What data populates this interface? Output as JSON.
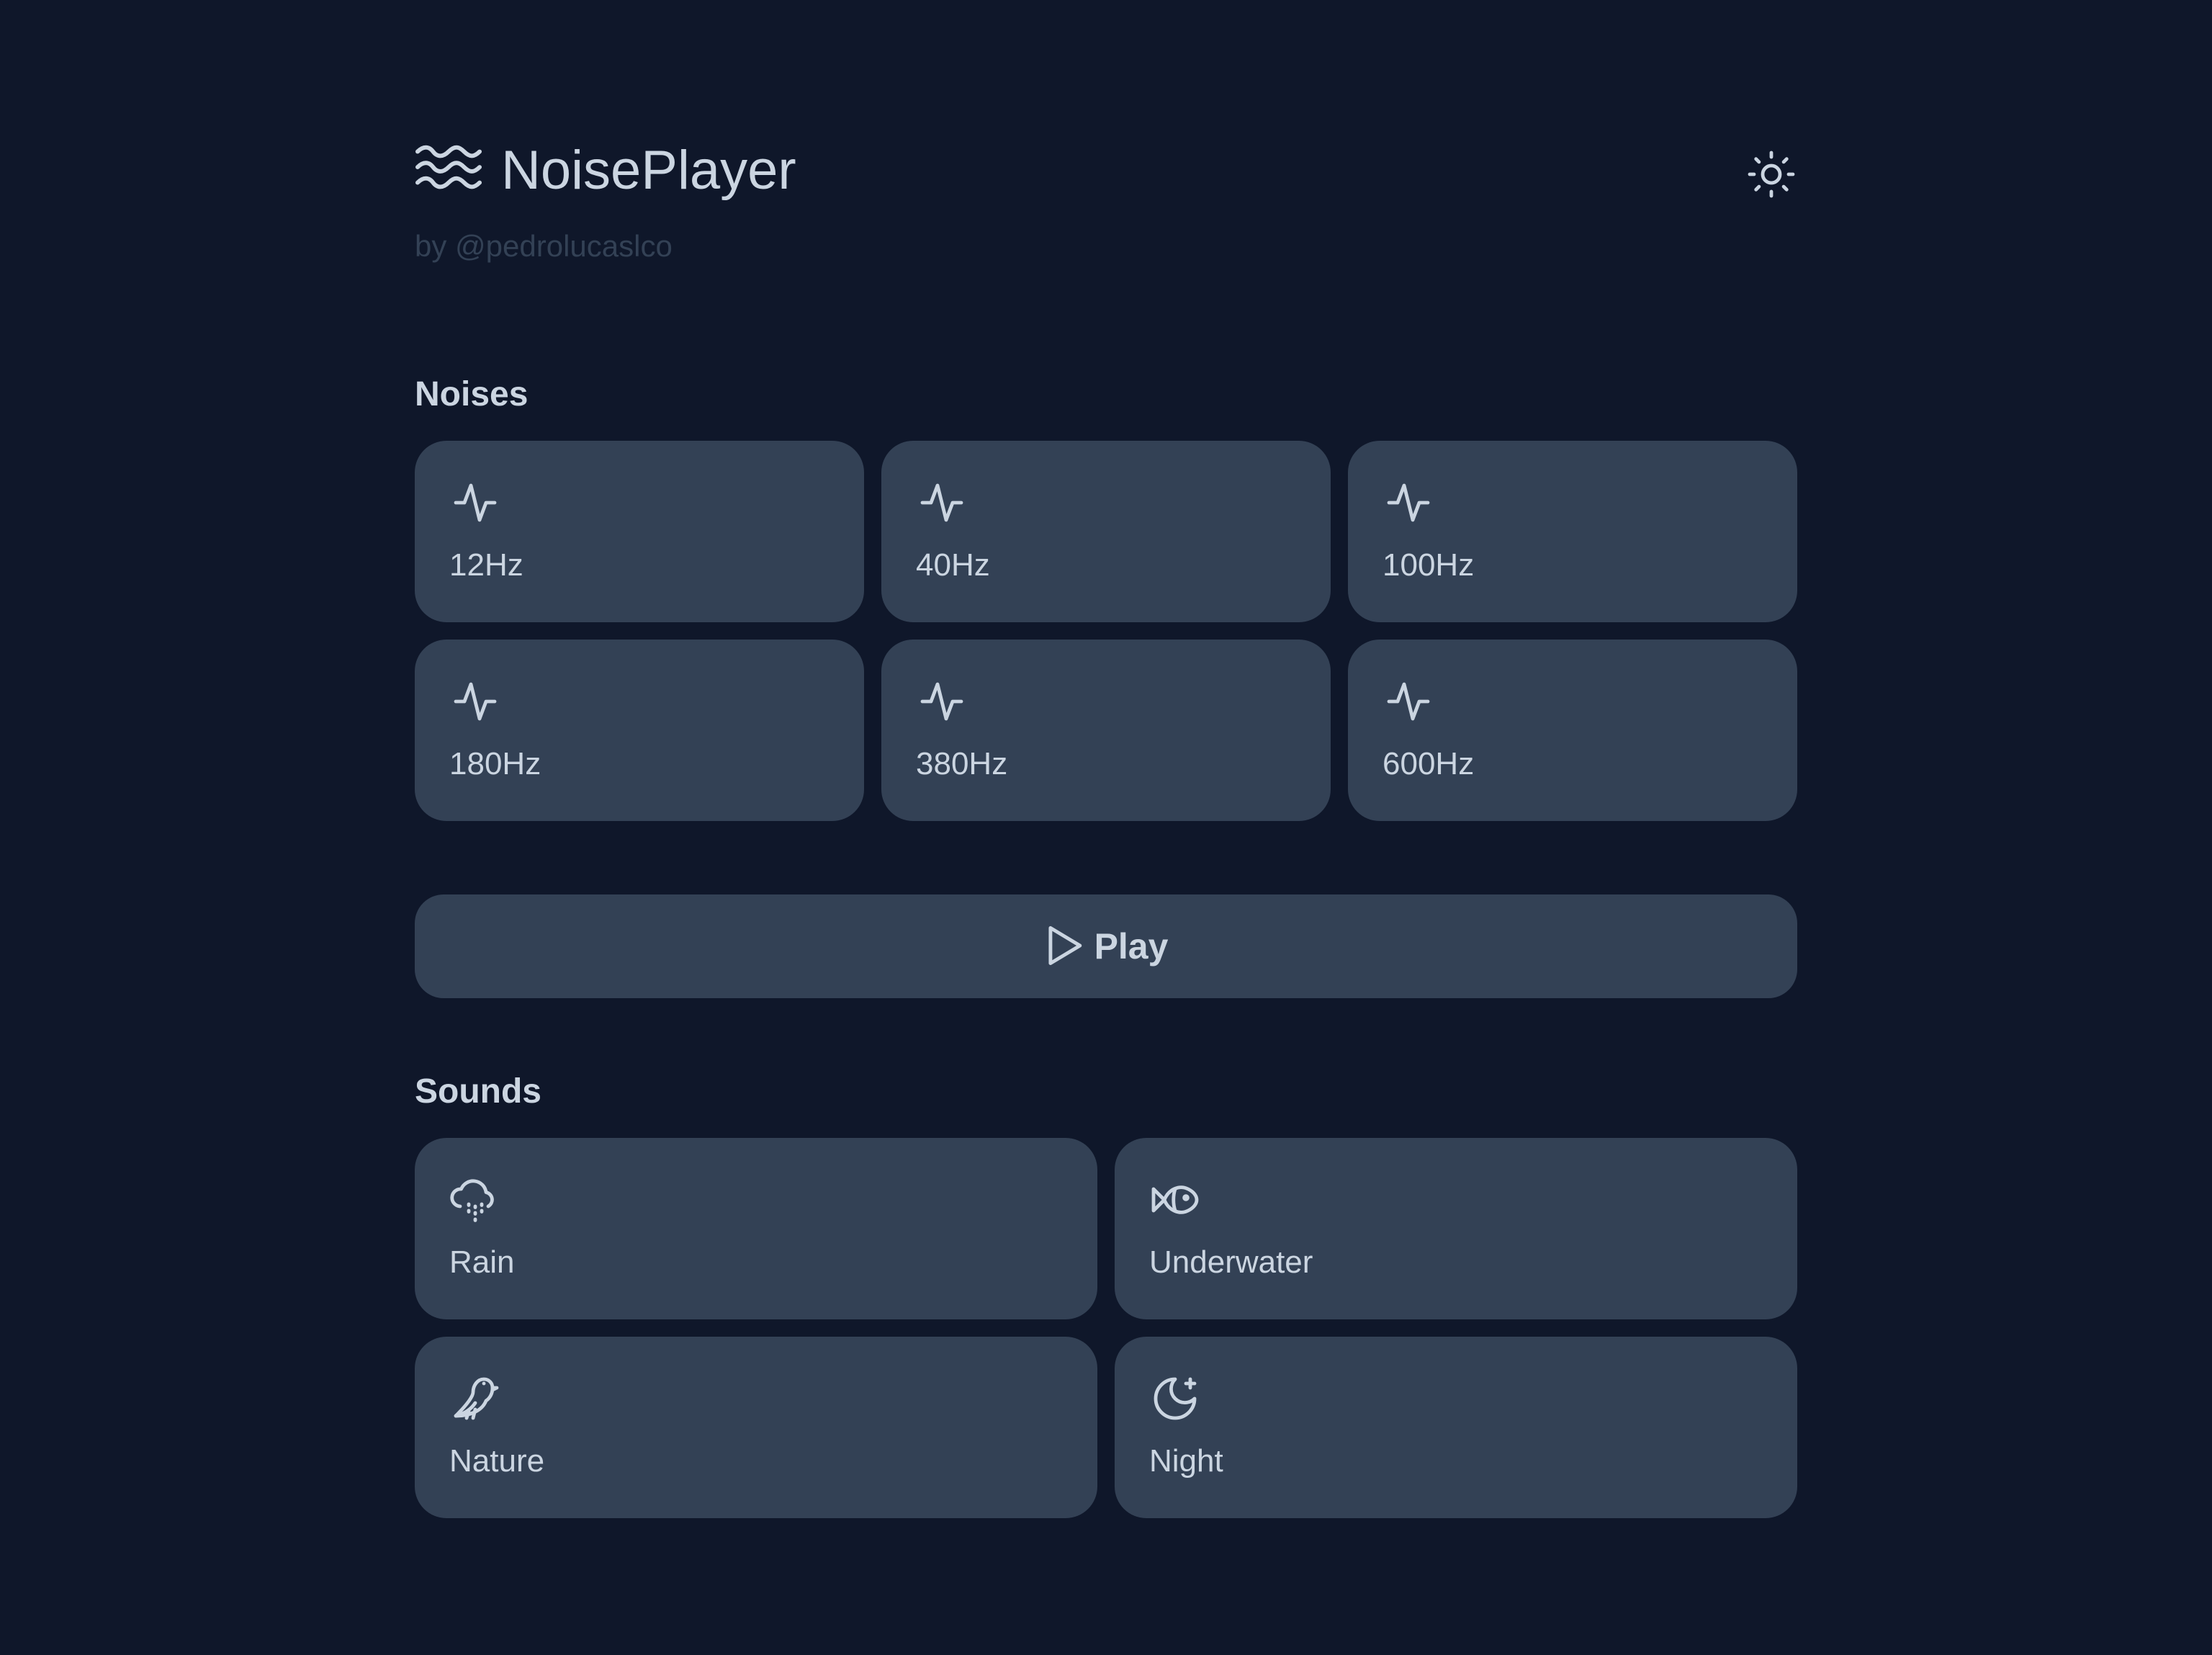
{
  "app": {
    "title": "NoisePlayer",
    "byline": "by @pedrolucaslco",
    "logo_icon": "waves-icon",
    "theme_toggle_icon": "sun-icon"
  },
  "noises": {
    "title": "Noises",
    "items": [
      {
        "label": "12Hz",
        "icon": "activity-icon"
      },
      {
        "label": "40Hz",
        "icon": "activity-icon"
      },
      {
        "label": "100Hz",
        "icon": "activity-icon"
      },
      {
        "label": "180Hz",
        "icon": "activity-icon"
      },
      {
        "label": "380Hz",
        "icon": "activity-icon"
      },
      {
        "label": "600Hz",
        "icon": "activity-icon"
      }
    ]
  },
  "player": {
    "play_label": "Play",
    "icon": "play-icon"
  },
  "sounds": {
    "title": "Sounds",
    "items": [
      {
        "label": "Rain",
        "icon": "cloud-rain-icon"
      },
      {
        "label": "Underwater",
        "icon": "fish-icon"
      },
      {
        "label": "Nature",
        "icon": "bird-icon"
      },
      {
        "label": "Night",
        "icon": "moon-star-icon"
      }
    ]
  },
  "colors": {
    "background": "#0f172a",
    "card": "#334155",
    "text": "#cbd5e1",
    "muted": "#334155"
  }
}
